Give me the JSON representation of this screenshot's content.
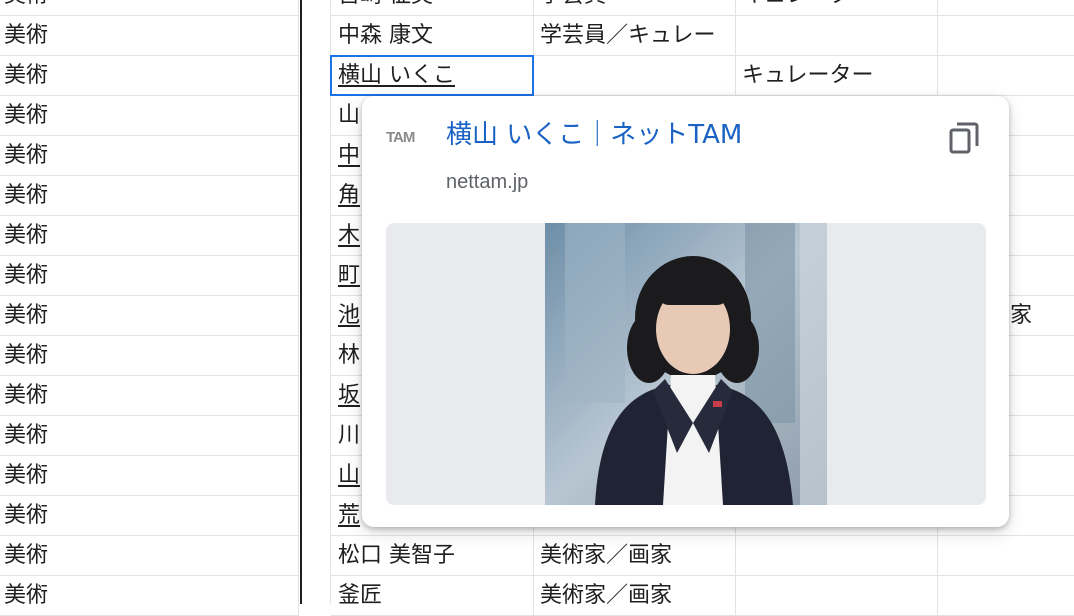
{
  "rows": [
    {
      "genre": "美術",
      "name": "宮崎 征英",
      "role": "学芸員",
      "title": "キュレーター",
      "extra": "",
      "name_link": false
    },
    {
      "genre": "美術",
      "name": "中森 康文",
      "role": "学芸員／キュレー",
      "title": "",
      "extra": "",
      "name_link": false
    },
    {
      "genre": "美術",
      "name": "横山 いくこ",
      "role": "",
      "title": "キュレーター",
      "extra": "",
      "name_link": true
    },
    {
      "genre": "美術",
      "name": "山",
      "role": "",
      "title": "",
      "extra": "",
      "name_link": false
    },
    {
      "genre": "美術",
      "name": "中",
      "role": "",
      "title": "",
      "extra": "",
      "name_link": true
    },
    {
      "genre": "美術",
      "name": "角",
      "role": "",
      "title": "",
      "extra": "",
      "name_link": true
    },
    {
      "genre": "美術",
      "name": "木",
      "role": "",
      "title": "",
      "extra": "",
      "name_link": true
    },
    {
      "genre": "美術",
      "name": "町",
      "role": "",
      "title": "",
      "extra": "",
      "name_link": true
    },
    {
      "genre": "美術",
      "name": "池",
      "role": "",
      "title": "",
      "extra": "工芸史家",
      "name_link": true
    },
    {
      "genre": "美術",
      "name": "林",
      "role": "",
      "title": "",
      "extra": "",
      "name_link": false
    },
    {
      "genre": "美術",
      "name": "坂",
      "role": "",
      "title": "",
      "extra": "",
      "name_link": true
    },
    {
      "genre": "美術",
      "name": "川",
      "role": "",
      "title": "",
      "extra": "",
      "name_link": false
    },
    {
      "genre": "美術",
      "name": "山",
      "role": "",
      "title": "",
      "extra": "",
      "name_link": true
    },
    {
      "genre": "美術",
      "name": "荒",
      "role": "",
      "title": "",
      "extra": "",
      "name_link": true
    },
    {
      "genre": "美術",
      "name": "松口 美智子",
      "role": "美術家／画家",
      "title": "",
      "extra": "",
      "name_link": false
    },
    {
      "genre": "美術",
      "name": "釜匠",
      "role": "美術家／画家",
      "title": "",
      "extra": "",
      "name_link": false
    }
  ],
  "preview": {
    "favicon_text": "TAM",
    "title": "横山 いくこ｜ネットTAM",
    "domain": "nettam.jp",
    "copy_icon": "copy-icon"
  },
  "colors": {
    "selection": "#1a73e8",
    "link_title": "#1a63c4"
  }
}
